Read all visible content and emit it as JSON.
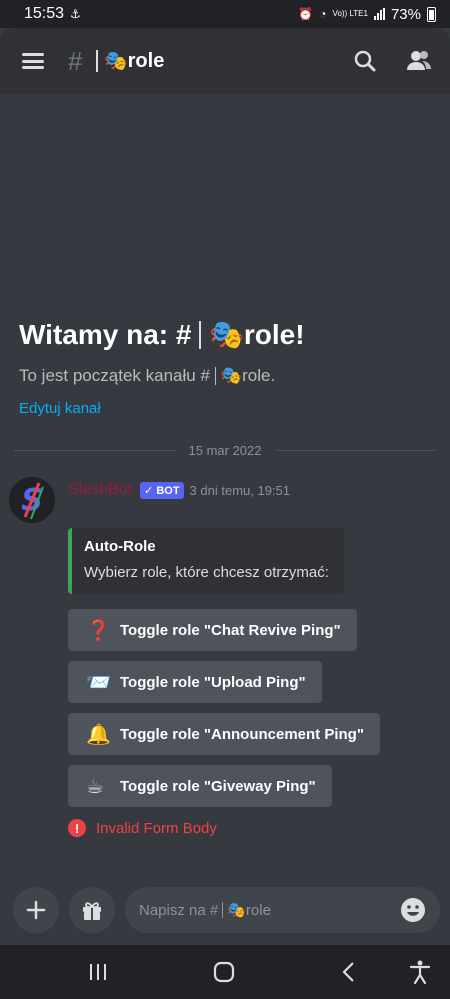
{
  "status_bar": {
    "time": "15:53",
    "network": "Vo)) LTE1",
    "battery": "73%"
  },
  "header": {
    "channel_emoji": "🎭",
    "channel_name": "role",
    "icons": [
      "hamburger-icon",
      "hash-icon",
      "search-icon",
      "members-icon"
    ]
  },
  "welcome": {
    "title_prefix": "Witamy na: #",
    "title_emoji": "🎭",
    "title_suffix": "role!",
    "subtitle_prefix": "To jest początek kanału #",
    "subtitle_emoji": "🎭",
    "subtitle_suffix": "role.",
    "edit_link": "Edytuj kanał"
  },
  "date_separator": "15 mar 2022",
  "message": {
    "author": "SlashBot",
    "bot_tag": "✓ BOT",
    "timestamp": "3 dni temu, 19:51",
    "author_color": "#9b1a3a",
    "embed": {
      "title": "Auto-Role",
      "description": "Wybierz role, które chcesz otrzymać:",
      "accent_color": "#3ba55c"
    },
    "buttons": [
      {
        "emoji": "❓",
        "label": "Toggle role \"Chat Revive Ping\""
      },
      {
        "emoji": "📨",
        "label": "Toggle role \"Upload Ping\""
      },
      {
        "emoji": "🔔",
        "label": "Toggle role \"Announcement Ping\""
      },
      {
        "emoji": "☕",
        "label": "Toggle role \"Giveway Ping\""
      }
    ],
    "error": {
      "icon": "!",
      "text": "Invalid Form Body"
    }
  },
  "composer": {
    "placeholder_prefix": "Napisz na #",
    "placeholder_emoji": "🎭",
    "placeholder_suffix": "role",
    "icons": [
      "plus-icon",
      "gift-icon",
      "emoji-icon"
    ]
  },
  "navbar": {
    "icons": [
      "recent-apps-icon",
      "home-icon",
      "back-icon",
      "accessibility-icon"
    ]
  }
}
